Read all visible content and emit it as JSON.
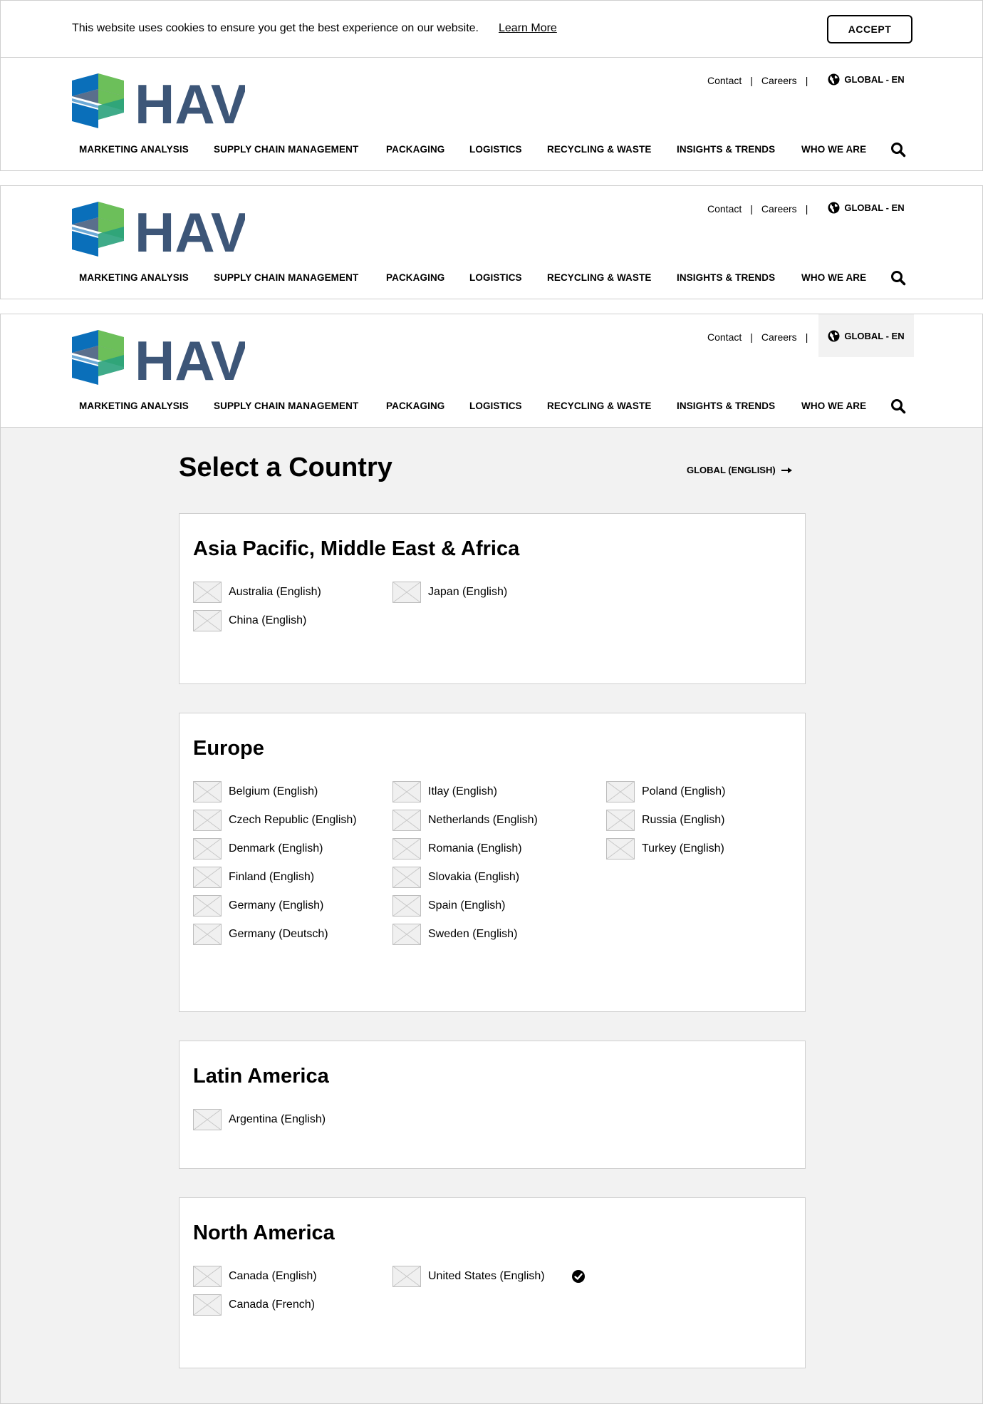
{
  "cookie": {
    "message": "This website uses cookies to ensure you get the best experience on our website.",
    "learn_more": "Learn More",
    "accept": "ACCEPT"
  },
  "header": {
    "logo_text": "HAVI",
    "top_links": [
      "Contact",
      "Careers"
    ],
    "separator": "|",
    "language": "GLOBAL - EN",
    "nav": [
      "MARKETING ANALYSIS",
      "SUPPLY CHAIN MANAGEMENT",
      "PACKAGING",
      "LOGISTICS",
      "RECYCLING & WASTE",
      "INSIGHTS & TRENDS",
      "WHO WE ARE"
    ],
    "icons": [
      "globe-icon",
      "search-icon"
    ]
  },
  "selector": {
    "title": "Select a Country",
    "global_link": "GLOBAL (ENGLISH)",
    "regions": [
      {
        "name": "Asia Pacific, Middle East & Africa",
        "columns": [
          [
            "Australia (English)",
            "China (English)"
          ],
          [
            "Japan (English)"
          ]
        ]
      },
      {
        "name": "Europe",
        "columns": [
          [
            "Belgium (English)",
            "Czech Republic (English)",
            "Denmark (English)",
            "Finland (English)",
            "Germany (English)",
            "Germany (Deutsch)"
          ],
          [
            "Itlay (English)",
            "Netherlands (English)",
            "Romania (English)",
            "Slovakia (English)",
            "Spain (English)",
            "Sweden (English)"
          ],
          [
            "Poland (English)",
            "Russia (English)",
            "Turkey (English)"
          ]
        ]
      },
      {
        "name": "Latin America",
        "columns": [
          [
            "Argentina (English)"
          ]
        ]
      },
      {
        "name": "North America",
        "columns": [
          [
            "Canada (English)",
            "Canada (French)"
          ],
          [
            "United States (English)"
          ]
        ],
        "selected": "United States (English)"
      }
    ]
  },
  "colors": {
    "logo_text": "#3d5678",
    "logo_blue": "#0a6fba",
    "logo_green": "#6cbf5a",
    "content_background": "#f2f2f2",
    "border": "#cfcfcf"
  }
}
